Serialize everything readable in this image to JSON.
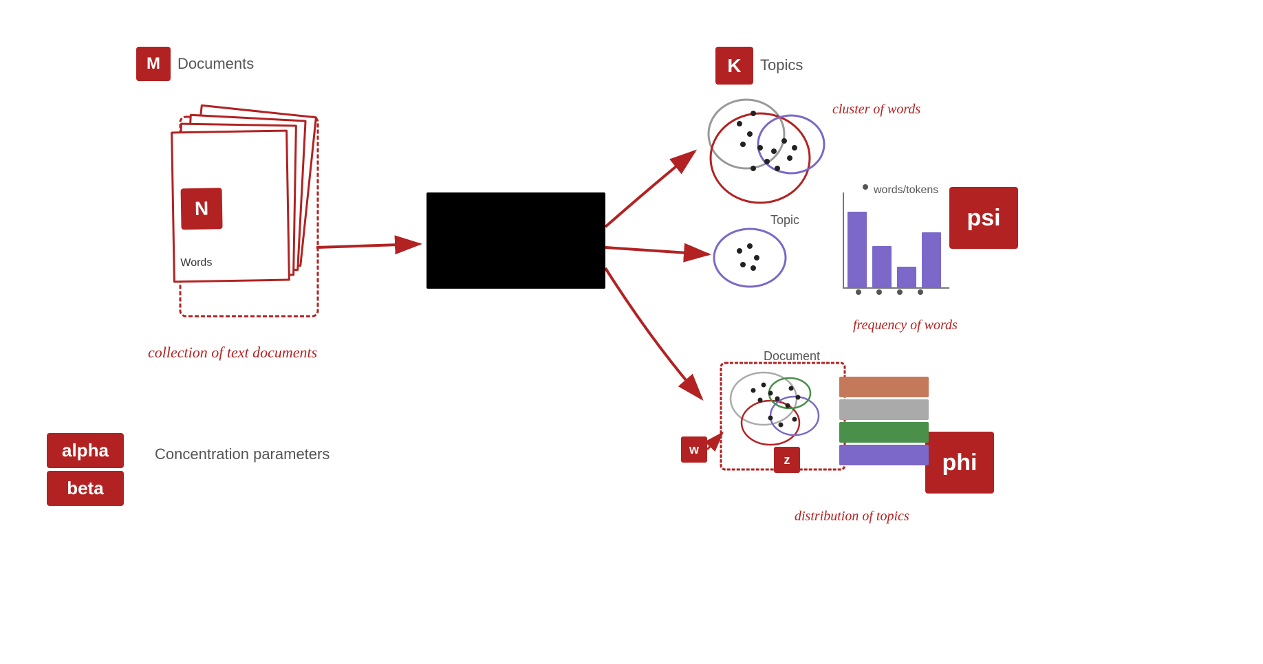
{
  "labels": {
    "m": "M",
    "documents": "Documents",
    "n": "N",
    "words": "Words",
    "collection": "collection of text documents",
    "alpha": "alpha",
    "beta": "beta",
    "concentration": "Concentration parameters",
    "k": "K",
    "topics": "Topics",
    "cluster_of_words": "cluster of words",
    "words_tokens": "words/tokens",
    "topic": "Topic",
    "document": "Document",
    "psi": "psi",
    "phi": "phi",
    "w": "w",
    "z": "z",
    "freq_label": "frequency of words",
    "dist_label": "distribution of topics"
  },
  "colors": {
    "red": "#b22222",
    "black": "#000000",
    "purple": "#7b68c8",
    "gray": "#888888",
    "green": "#4a8f4a",
    "tan": "#c47a5a",
    "white": "#ffffff"
  },
  "bars_psi": [
    110,
    60,
    30,
    90
  ],
  "bars_phi": [
    "#c47a5a",
    "#aaaaaa",
    "#4a8f4a",
    "#7b68c8"
  ]
}
